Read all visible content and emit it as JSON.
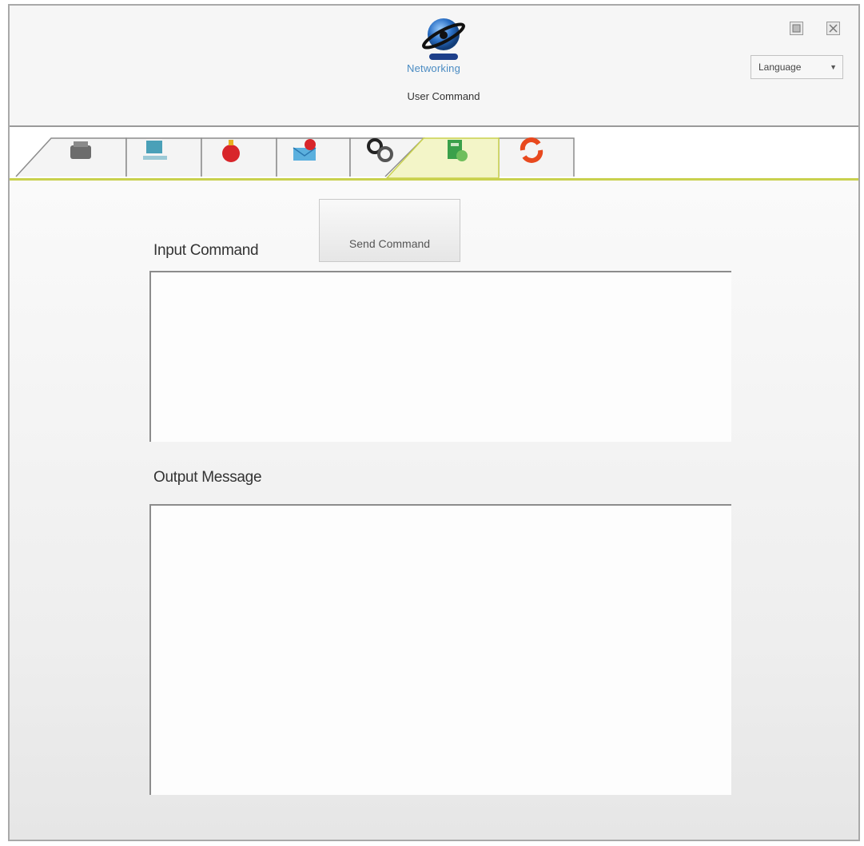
{
  "app": {
    "logo_text": "Networking",
    "title": "User Command"
  },
  "window_controls": {
    "minimize_icon": "minimize-icon",
    "close_icon": "close-icon"
  },
  "language_select": {
    "selected": "Language",
    "arrow_icon": "chevron-down-icon"
  },
  "tabs": [
    {
      "icon": "printer-icon",
      "active": false
    },
    {
      "icon": "network-device-icon",
      "active": false
    },
    {
      "icon": "alert-bomb-icon",
      "active": false
    },
    {
      "icon": "mail-alert-icon",
      "active": false
    },
    {
      "icon": "gears-icon",
      "active": false
    },
    {
      "icon": "user-command-icon",
      "active": true
    },
    {
      "icon": "refresh-icon",
      "active": false
    }
  ],
  "command_panel": {
    "send_button_label": "Send Command",
    "input_label": "Input Command",
    "input_value": "",
    "output_label": "Output Message",
    "output_value": ""
  },
  "colors": {
    "accent_line": "#c9d14e",
    "active_tab": "#f3f5c8",
    "logo_blue": "#2a6fc4"
  }
}
